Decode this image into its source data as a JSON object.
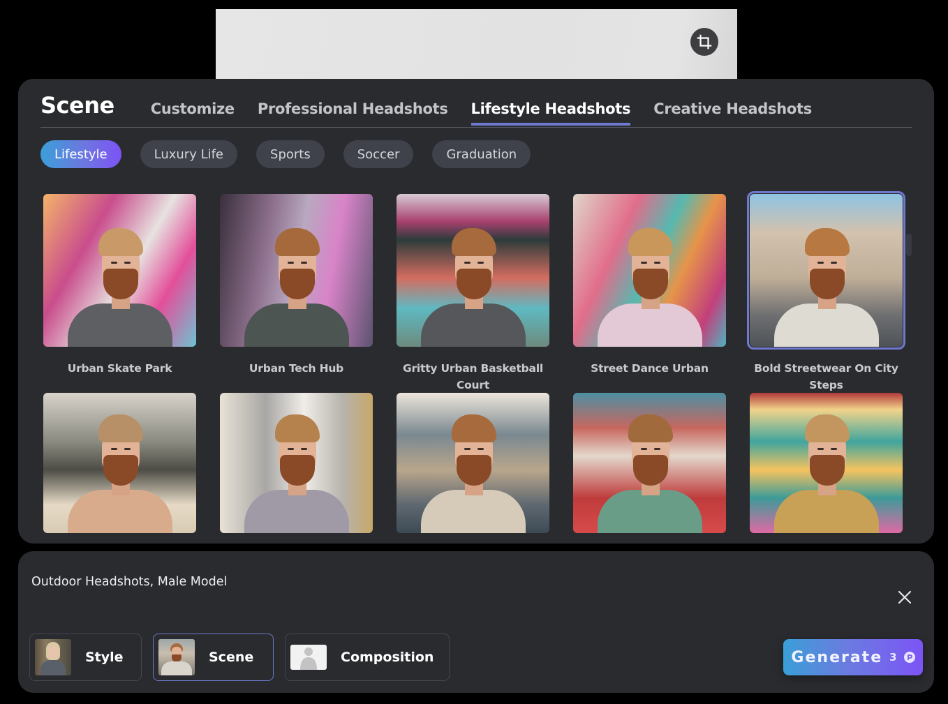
{
  "preview": {
    "crop_icon": "crop-icon"
  },
  "scene_panel": {
    "title": "Scene",
    "tabs": [
      {
        "label": "Customize",
        "active": false
      },
      {
        "label": "Professional Headshots",
        "active": false
      },
      {
        "label": "Lifestyle Headshots",
        "active": true
      },
      {
        "label": "Creative Headshots",
        "active": false
      }
    ],
    "chips": [
      {
        "label": "Lifestyle",
        "active": true
      },
      {
        "label": "Luxury Life",
        "active": false
      },
      {
        "label": "Sports",
        "active": false
      },
      {
        "label": "Soccer",
        "active": false
      },
      {
        "label": "Graduation",
        "active": false
      }
    ],
    "scenes": [
      {
        "caption": "Urban Skate Park",
        "selected": false
      },
      {
        "caption": "Urban Tech Hub",
        "selected": false
      },
      {
        "caption": "Gritty Urban Basketball Court",
        "selected": false
      },
      {
        "caption": "Street Dance Urban",
        "selected": false
      },
      {
        "caption": "Bold Streetwear On City Steps",
        "selected": true
      },
      {
        "caption": "",
        "selected": false
      },
      {
        "caption": "",
        "selected": false
      },
      {
        "caption": "",
        "selected": false
      },
      {
        "caption": "",
        "selected": false
      },
      {
        "caption": "",
        "selected": false
      }
    ]
  },
  "prompt_panel": {
    "prompt": "Outdoor Headshots, Male Model",
    "close_icon": "close-icon",
    "options": [
      {
        "label": "Style",
        "active": false
      },
      {
        "label": "Scene",
        "active": true
      },
      {
        "label": "Composition",
        "active": false
      }
    ],
    "generate": {
      "label": "Generate",
      "cost": "3",
      "icon": "credit-coin-icon"
    }
  },
  "colors": {
    "accent": "#7079d0",
    "panel": "#2a2b2f",
    "chip": "#3f424b",
    "gradient_start": "#3a9fd8",
    "gradient_end": "#7d54f6"
  }
}
